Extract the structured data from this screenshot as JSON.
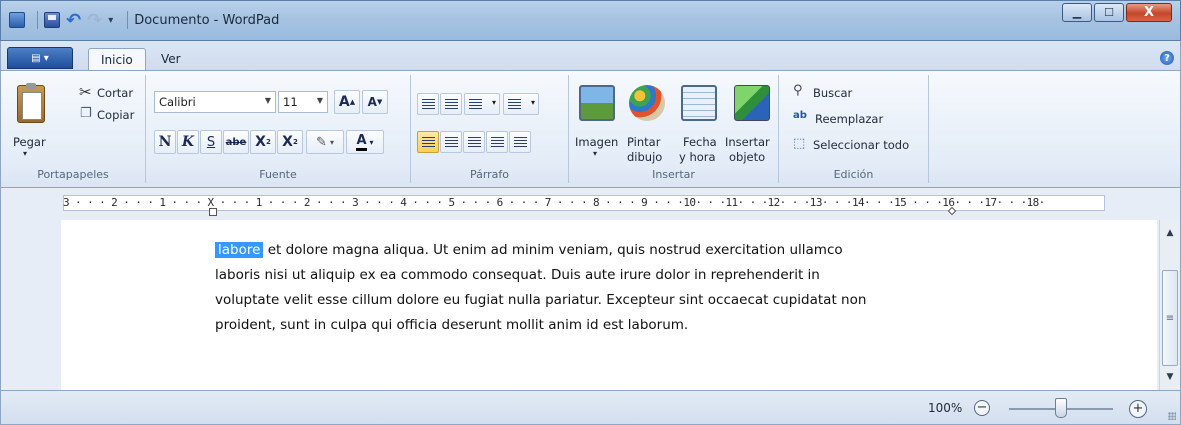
{
  "window": {
    "title": "Documento - WordPad",
    "minimize": "▁",
    "maximize": "☐",
    "close": "X"
  },
  "tabs": [
    {
      "label": "Inicio",
      "active": true
    },
    {
      "label": "Ver",
      "active": false
    }
  ],
  "ribbon": {
    "clipboard": {
      "paste_label": "Pegar",
      "cut_label": "Cortar",
      "copy_label": "Copiar",
      "group_label": "Portapapeles"
    },
    "font": {
      "font_name": "Calibri",
      "font_size": "11",
      "grow_font": "A",
      "shrink_font": "A",
      "bold": "N",
      "italic": "K",
      "underline": "S",
      "strikethrough": "abe",
      "subscript": "X",
      "superscript": "X",
      "font_color": "A",
      "group_label": "Fuente"
    },
    "paragraph": {
      "group_label": "Párrafo"
    },
    "insert": {
      "image_label": "Imagen",
      "paint_label_1": "Pintar",
      "paint_label_2": "dibujo",
      "datetime_label_1": "Fecha",
      "datetime_label_2": "y hora",
      "object_label_1": "Insertar",
      "object_label_2": "objeto",
      "group_label": "Insertar"
    },
    "editing": {
      "find_label": "Buscar",
      "replace_label": "Reemplazar",
      "select_all_label": "Seleccionar todo",
      "group_label": "Edición"
    }
  },
  "ruler": {
    "text": "3 · · · 2 · · · 1 · · · X · · · 1 · · · 2 · · · 3 · · · 4 · · · 5 · · · 6 · · · 7 · · · 8 · · · 9 · · ·10· · ·11· · ·12· · ·13· · ·14· · ·15 · · ·16· · ·17· · ·18·"
  },
  "document": {
    "selected_word": "labore",
    "line1_rest": " et dolore magna aliqua. Ut enim ad minim veniam, quis nostrud exercitation ullamco",
    "line2": "laboris nisi ut aliquip ex ea commodo consequat. Duis aute irure dolor in reprehenderit in",
    "line3": "voluptate velit esse cillum dolore eu fugiat nulla pariatur. Excepteur sint occaecat cupidatat non",
    "line4": "proident, sunt in culpa qui officia deserunt mollit anim id est laborum."
  },
  "statusbar": {
    "zoom": "100%",
    "zoom_fraction": 0.5
  },
  "colors": {
    "selection": "#3399ff",
    "title_bar": "#a7c3e2",
    "ribbon_bg": "#e3ecf7"
  }
}
